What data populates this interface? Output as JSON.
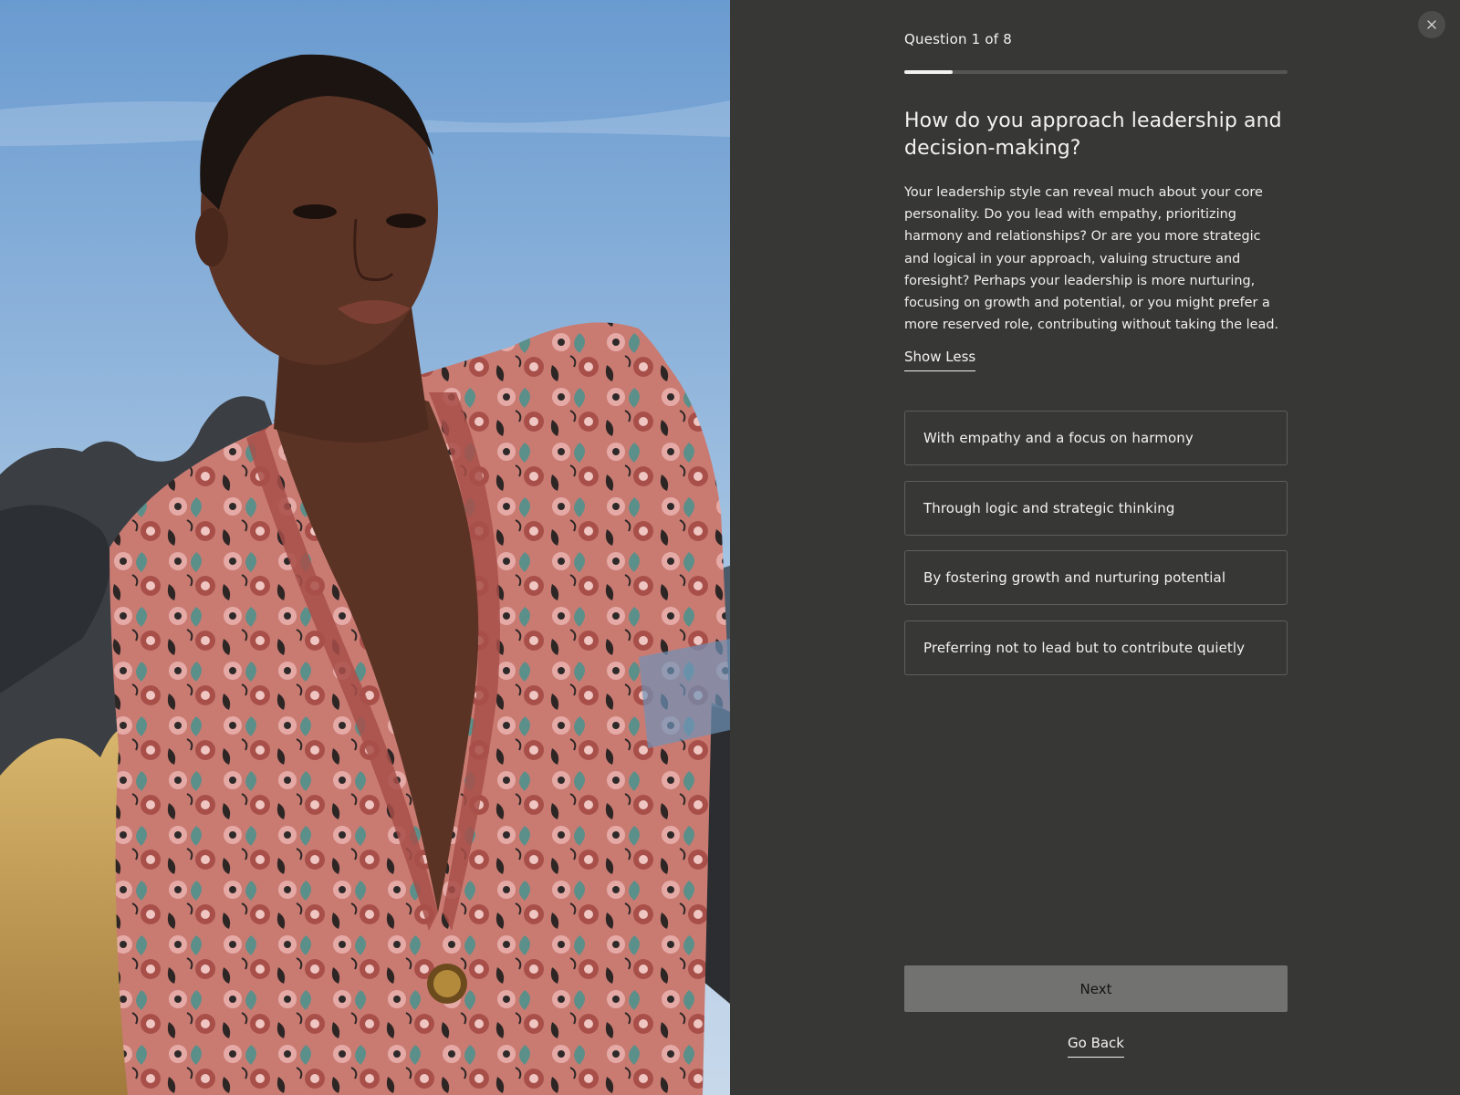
{
  "photo": {
    "alt_icon": "model-photo",
    "colors": {
      "sky": "#7eaad6",
      "rock": "#3a3d40",
      "grass": "#c9a35a",
      "jacket": "#c97b72",
      "skin": "#5a3325"
    }
  },
  "quiz": {
    "close_icon": "close-icon",
    "step_label": "Question 1 of 8",
    "progress": {
      "current": 1,
      "total": 8,
      "fraction": 0.125
    },
    "question": "How do you approach leadership and decision-making?",
    "description": "Your leadership style can reveal much about your core personality. Do you lead with empathy, prioritizing harmony and relationships? Or are you more strategic and logical in your approach, valuing structure and foresight? Perhaps your leadership is more nurturing, focusing on growth and potential, or you might prefer a more reserved role, contributing without taking the lead.",
    "toggle_label": "Show Less",
    "options": [
      {
        "label": "With empathy and a focus on harmony"
      },
      {
        "label": "Through logic and strategic thinking"
      },
      {
        "label": "By fostering growth and nurturing potential"
      },
      {
        "label": "Preferring not to lead but to contribute quietly"
      }
    ],
    "next_label": "Next",
    "back_label": "Go Back"
  },
  "theme": {
    "panel_bg": "#373736",
    "text": "#f4f2ee",
    "option_border": "#5e5e5c",
    "next_bg": "#727270"
  }
}
